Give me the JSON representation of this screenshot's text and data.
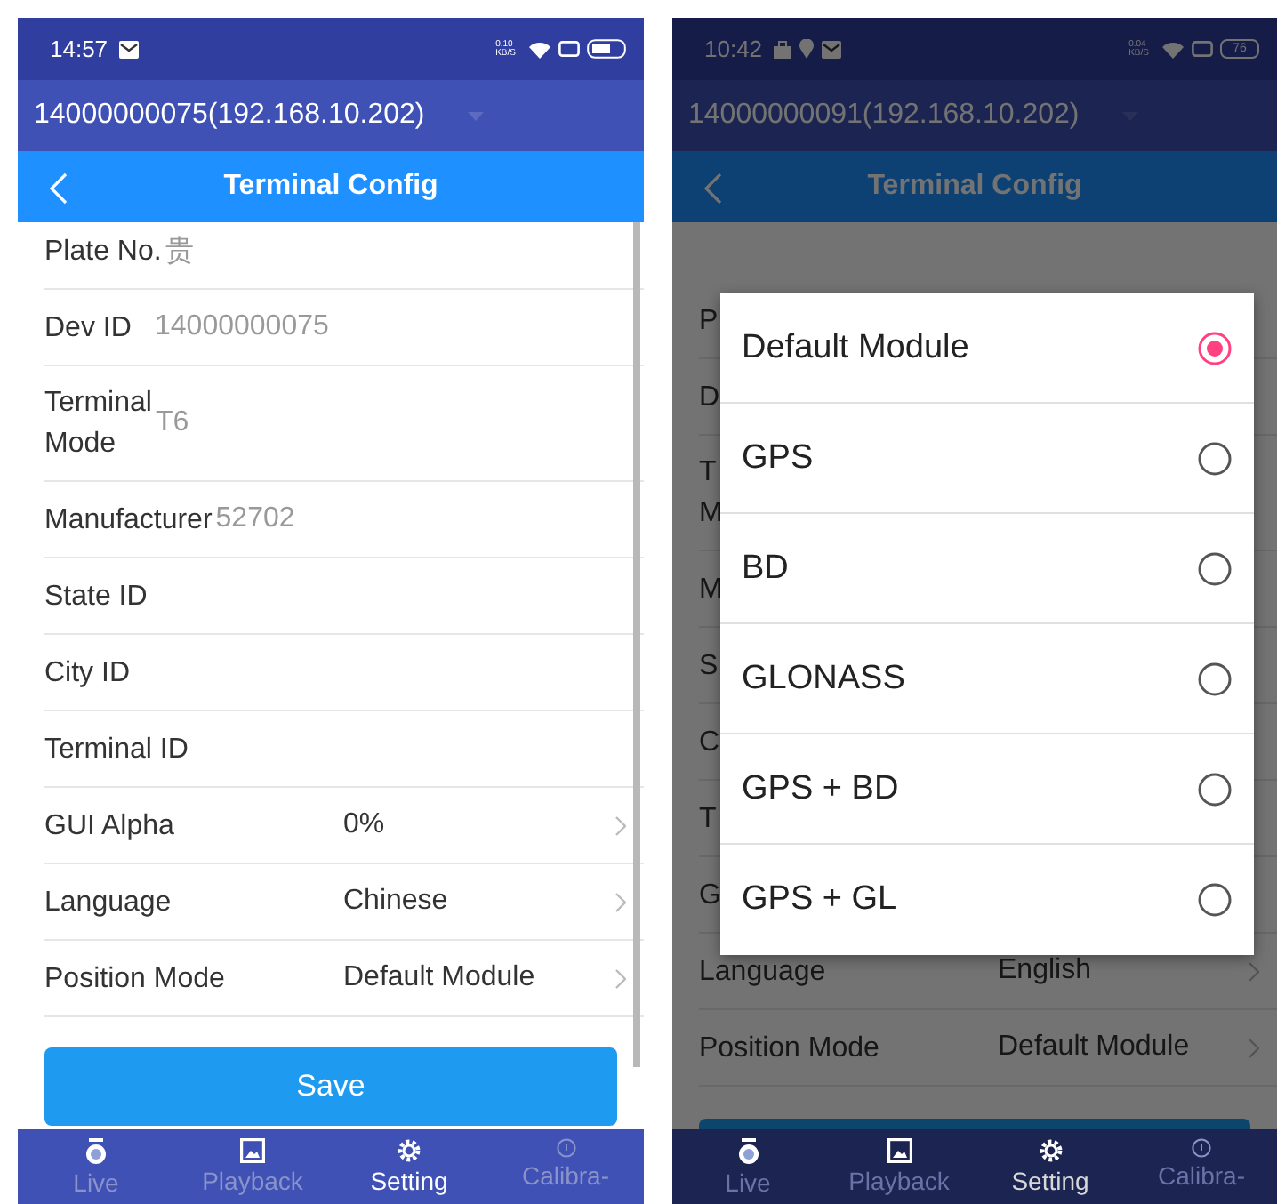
{
  "phones": [
    {
      "status_bar": {
        "time": "14:57",
        "speed_value": "0.10",
        "speed_unit": "KB/S"
      },
      "device": "14000000075(192.168.10.202)",
      "header_title": "Terminal Config",
      "scrolled": true,
      "rows": [
        {
          "kind": "text",
          "label": "Plate No.",
          "value": "贵"
        },
        {
          "kind": "text",
          "label": "Dev ID",
          "value": "14000000075"
        },
        {
          "kind": "text",
          "label": "Terminal\nMode",
          "value": "T6"
        },
        {
          "kind": "text",
          "label": "Manufacturer",
          "value": "52702"
        },
        {
          "kind": "text",
          "label": "State ID"
        },
        {
          "kind": "text",
          "label": "City ID"
        },
        {
          "kind": "text",
          "label": "Terminal ID"
        },
        {
          "kind": "select",
          "label": "GUI Alpha",
          "value": "0%"
        },
        {
          "kind": "select",
          "label": "Language",
          "value": "Chinese"
        },
        {
          "kind": "select",
          "label": "Position Mode",
          "value": "Default Module"
        }
      ],
      "save_label": "Save",
      "nav": [
        {
          "label": "Live",
          "selected": false
        },
        {
          "label": "Playback",
          "selected": false
        },
        {
          "label": "Setting",
          "selected": true
        },
        {
          "label": "Calibra-",
          "selected": false
        }
      ]
    },
    {
      "status_bar": {
        "time": "10:42",
        "speed_value": "0.04",
        "speed_unit": "KB/S",
        "battery": "76"
      },
      "device": "14000000091(192.168.10.202)",
      "header_title": "Terminal Config",
      "scrolled": false,
      "rows": [
        {
          "kind": "text",
          "label": "P"
        },
        {
          "kind": "text",
          "label": "D"
        },
        {
          "kind": "text",
          "label": "T\nM"
        },
        {
          "kind": "text",
          "label": "M"
        },
        {
          "kind": "text",
          "label": "S"
        },
        {
          "kind": "text",
          "label": "C"
        },
        {
          "kind": "text",
          "label": "T"
        },
        {
          "kind": "text",
          "label": "G"
        },
        {
          "kind": "select",
          "label": "Language",
          "value": "English"
        },
        {
          "kind": "select",
          "label": "Position Mode",
          "value": "Default Module"
        }
      ],
      "nav": [
        {
          "label": "Live",
          "selected": false
        },
        {
          "label": "Playback",
          "selected": false
        },
        {
          "label": "Setting",
          "selected": true
        },
        {
          "label": "Calibra-",
          "selected": false
        }
      ],
      "dialog": {
        "options": [
          {
            "label": "Default Module",
            "selected": true
          },
          {
            "label": "GPS",
            "selected": false
          },
          {
            "label": "BD",
            "selected": false
          },
          {
            "label": "GLONASS",
            "selected": false
          },
          {
            "label": "GPS + BD",
            "selected": false
          },
          {
            "label": "GPS + GL",
            "selected": false
          }
        ]
      }
    }
  ]
}
